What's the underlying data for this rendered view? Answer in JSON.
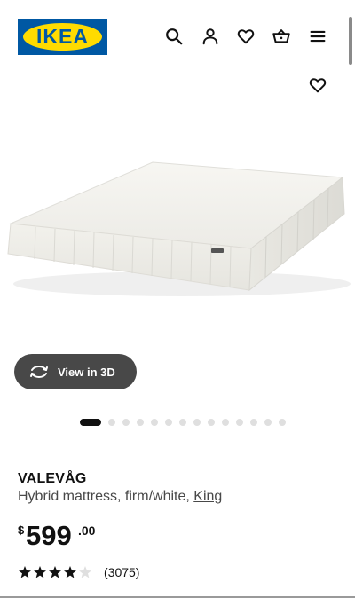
{
  "header": {
    "logo_text": "IKEA",
    "icons": [
      "search-icon",
      "account-icon",
      "favourites-icon",
      "cart-icon",
      "menu-icon"
    ]
  },
  "product": {
    "brand": "VALEVÅG",
    "description": "Hybrid mattress, firm/white,",
    "size_link": "King",
    "price": {
      "currency": "$",
      "integer": "599",
      "decimal": ".00"
    },
    "rating": {
      "value": 4,
      "max": 5,
      "count": "(3075)"
    }
  },
  "gallery": {
    "view3d_label": "View in 3D",
    "total_images": 14,
    "active_index": 0
  },
  "colors": {
    "ikea_blue": "#0058a3",
    "ikea_yellow": "#ffdb00",
    "button_dark": "#484848"
  }
}
